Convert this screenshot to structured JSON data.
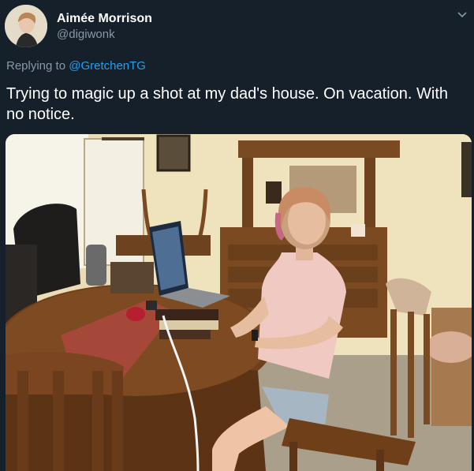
{
  "author": {
    "display_name": "Aimée Morrison",
    "handle": "@digiwonk",
    "avatar_icon": "avatar-photo"
  },
  "reply": {
    "prefix": "Replying to ",
    "mention": "@GretchenTG"
  },
  "tweet": {
    "text": "Trying to magic up a shot at my dad's house. On vacation. With no notice."
  },
  "menu_icon": "chevron-down-icon",
  "media": {
    "description_icon": "photo-woman-at-laptop-dining-room"
  },
  "colors": {
    "background": "#15202b",
    "text_primary": "#ffffff",
    "text_secondary": "#8899a6",
    "link": "#1da1f2"
  }
}
